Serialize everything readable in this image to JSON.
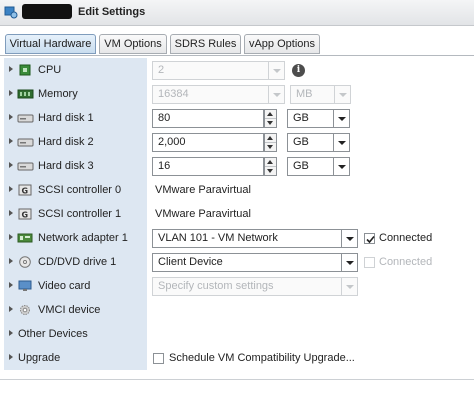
{
  "window": {
    "title": "Edit Settings",
    "title_icon": "vm-gear-icon"
  },
  "tabs": [
    {
      "label": "Virtual Hardware",
      "active": true
    },
    {
      "label": "VM Options",
      "active": false
    },
    {
      "label": "SDRS Rules",
      "active": false
    },
    {
      "label": "vApp Options",
      "active": false
    }
  ],
  "rows": {
    "cpu": {
      "label": "CPU",
      "icon": "cpu-icon",
      "value": "2"
    },
    "memory": {
      "label": "Memory",
      "icon": "memory-icon",
      "value": "16384",
      "unit": "MB"
    },
    "hdd1": {
      "label": "Hard disk 1",
      "icon": "hard-disk-icon",
      "value": "80",
      "unit": "GB"
    },
    "hdd2": {
      "label": "Hard disk 2",
      "icon": "hard-disk-icon",
      "value": "2,000",
      "unit": "GB"
    },
    "hdd3": {
      "label": "Hard disk 3",
      "icon": "hard-disk-icon",
      "value": "16",
      "unit": "GB"
    },
    "scsi0": {
      "label": "SCSI controller 0",
      "icon": "scsi-controller-icon",
      "value": "VMware Paravirtual"
    },
    "scsi1": {
      "label": "SCSI controller 1",
      "icon": "scsi-controller-icon",
      "value": "VMware Paravirtual"
    },
    "net": {
      "label": "Network adapter 1",
      "icon": "network-adapter-icon",
      "value": "VLAN 101 - VM Network",
      "connected_label": "Connected",
      "connected": true
    },
    "cd": {
      "label": "CD/DVD drive 1",
      "icon": "cd-dvd-icon",
      "value": "Client Device",
      "connected_label": "Connected",
      "connected": false
    },
    "video": {
      "label": "Video card",
      "icon": "video-card-icon",
      "value": "Specify custom settings"
    },
    "vmci": {
      "label": "VMCI device",
      "icon": "vmci-device-icon"
    },
    "other": {
      "label": "Other Devices"
    },
    "upgrade": {
      "label": "Upgrade",
      "checkbox_label": "Schedule VM Compatibility Upgrade..."
    }
  },
  "colors": {
    "label_column": "#dde7f2",
    "active_tab": "#c9ddef"
  }
}
